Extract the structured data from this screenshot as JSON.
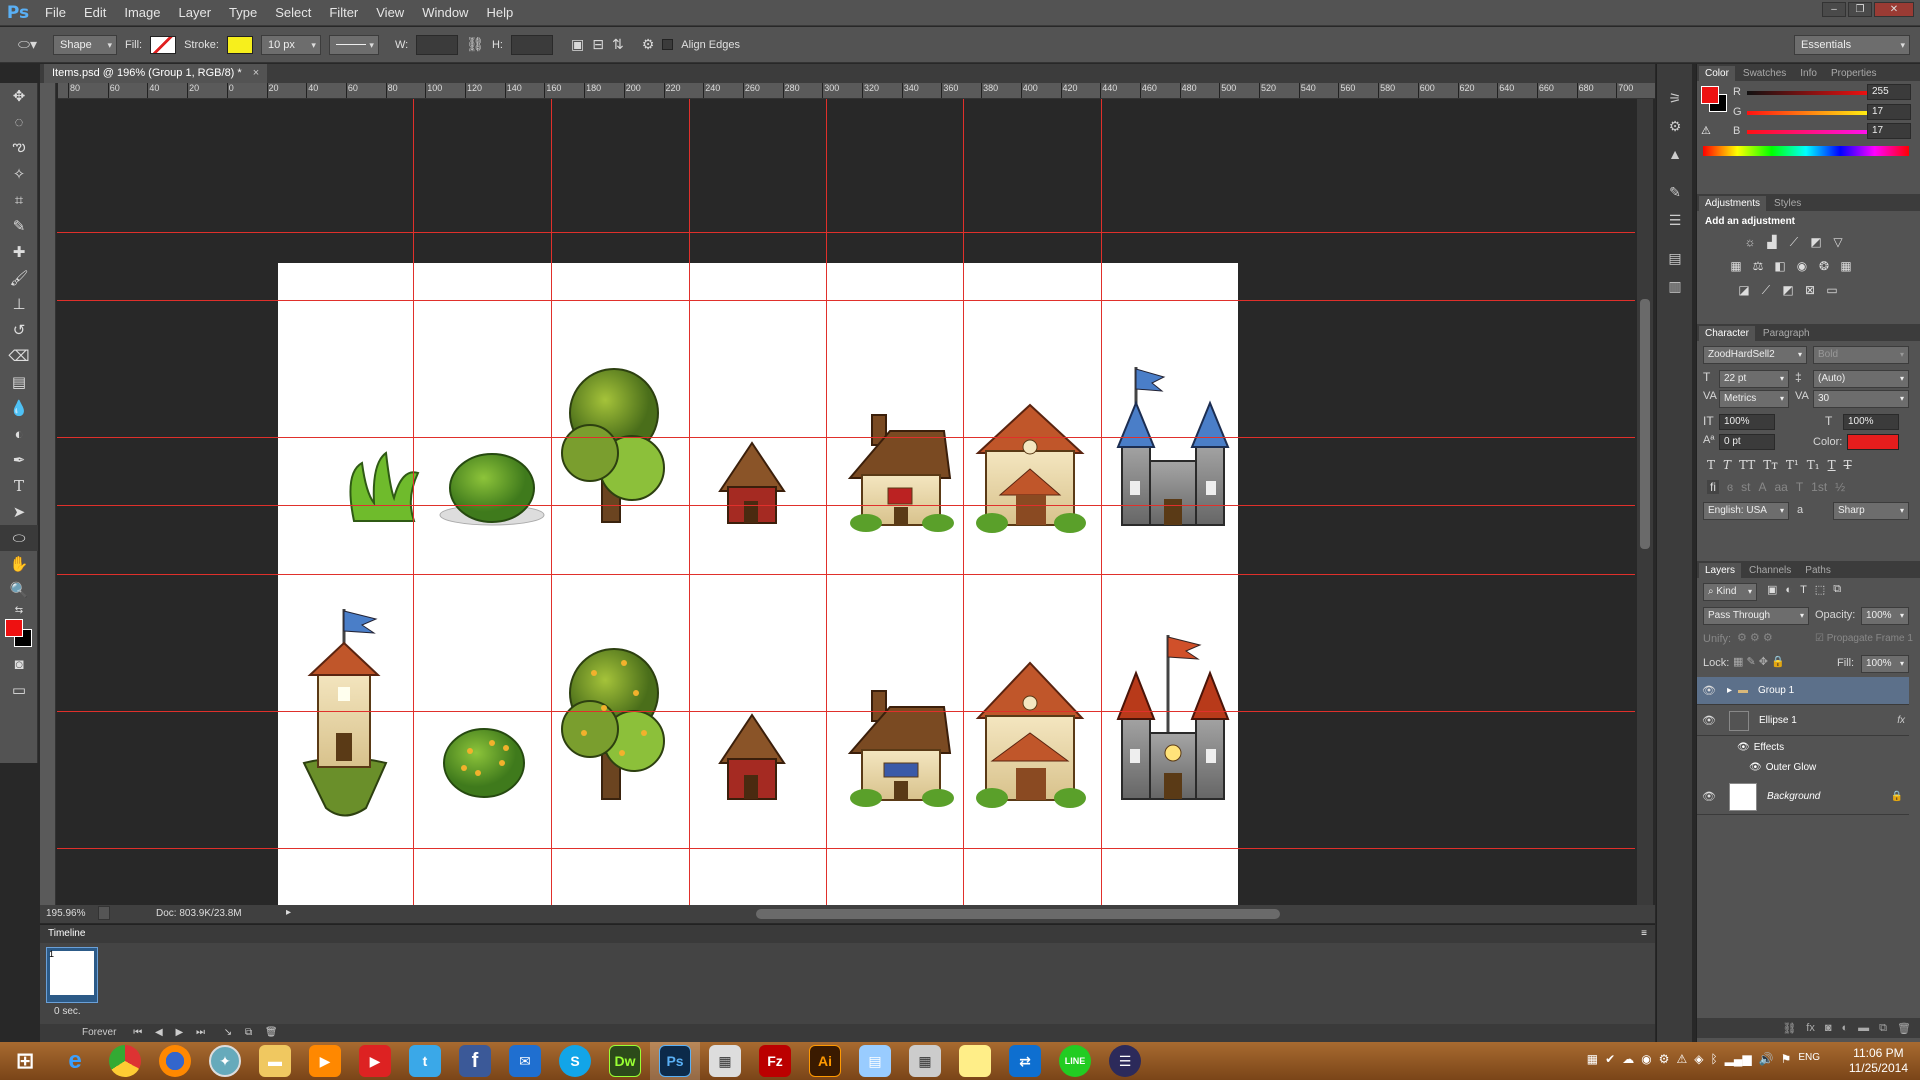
{
  "app": {
    "logo": "Ps"
  },
  "menu": [
    "File",
    "Edit",
    "Image",
    "Layer",
    "Type",
    "Select",
    "Filter",
    "View",
    "Window",
    "Help"
  ],
  "options": {
    "shape_mode": "Shape",
    "fill_label": "Fill:",
    "stroke_label": "Stroke:",
    "stroke_color": "#f7ef1c",
    "stroke_size": "10 px",
    "w_label": "W:",
    "h_label": "H:",
    "align_edges": "Align Edges",
    "workspace": "Essentials"
  },
  "document": {
    "tab_title": "Items.psd @ 196% (Group 1, RGB/8) *",
    "zoom": "195.96%",
    "doc_size": "Doc: 803.9K/23.8M",
    "ruler_labels": [
      "80",
      "60",
      "40",
      "20",
      "0",
      "20",
      "40",
      "60",
      "80",
      "100",
      "120",
      "140",
      "160",
      "180",
      "200",
      "220",
      "240",
      "260",
      "280",
      "300",
      "320",
      "340",
      "360",
      "380",
      "400",
      "420",
      "440",
      "460",
      "480",
      "500",
      "520",
      "540",
      "560",
      "580",
      "600",
      "620",
      "640",
      "660",
      "680",
      "700"
    ]
  },
  "sprites": {
    "row1": [
      "grass",
      "bush",
      "tree",
      "hut",
      "cottage",
      "house",
      "castle-blue"
    ],
    "row2": [
      "tower",
      "berry-bush",
      "fruit-tree",
      "hut",
      "cottage",
      "house",
      "castle-red"
    ]
  },
  "timeline": {
    "title": "Timeline",
    "frame_number": "1",
    "frame_delay": "0 sec.",
    "loop": "Forever"
  },
  "color_panel": {
    "tabs": [
      "Color",
      "Swatches",
      "Info",
      "Properties"
    ],
    "r_label": "R",
    "g_label": "G",
    "b_label": "B",
    "r": "255",
    "g": "17",
    "b": "17",
    "foreground": "#ee1111"
  },
  "adjustments": {
    "tabs": [
      "Adjustments",
      "Styles"
    ],
    "heading": "Add an adjustment"
  },
  "character": {
    "tabs": [
      "Character",
      "Paragraph"
    ],
    "font": "ZoodHardSell2",
    "style": "Bold",
    "size": "22 pt",
    "leading": "(Auto)",
    "kerning": "Metrics",
    "tracking": "30",
    "vscale": "100%",
    "hscale": "100%",
    "baseline": "0 pt",
    "color_label": "Color:",
    "color": "#e51d1d",
    "language": "English: USA",
    "aa_label": "a",
    "antialias": "Sharp"
  },
  "layers": {
    "tabs": [
      "Layers",
      "Channels",
      "Paths"
    ],
    "filter": "Kind",
    "blend": "Pass Through",
    "opacity_label": "Opacity:",
    "opacity": "100%",
    "unify_label": "Unify:",
    "propagate": "Propagate Frame 1",
    "lock_label": "Lock:",
    "fill_label": "Fill:",
    "fill": "100%",
    "items": [
      {
        "name": "Group 1"
      },
      {
        "name": "Ellipse 1",
        "fx": "fx"
      },
      {
        "name": "Effects"
      },
      {
        "name": "Outer Glow"
      },
      {
        "name": "Background"
      }
    ]
  },
  "taskbar": {
    "time": "11:06 PM",
    "date": "11/25/2014",
    "lang": "ENG"
  }
}
